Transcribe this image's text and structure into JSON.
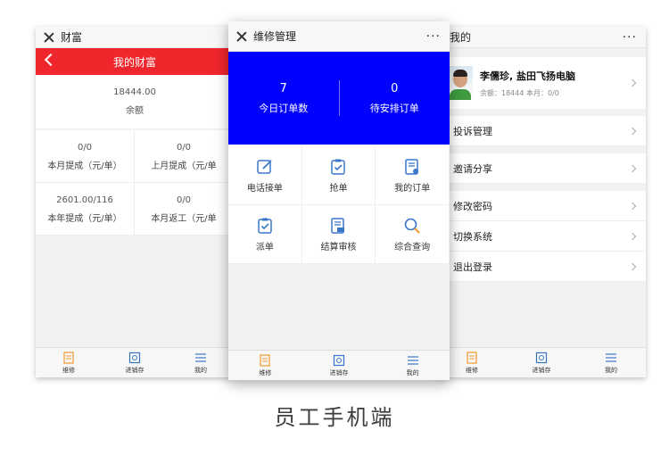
{
  "left_phone": {
    "window_title": "财富",
    "header_title": "我的财富",
    "balance": {
      "amount": "18444.00",
      "label": "余额"
    },
    "stats": [
      {
        "value": "0/0",
        "label": "本月提成（元/单）"
      },
      {
        "value": "0/0",
        "label": "上月提成（元/单"
      },
      {
        "value": "2601.00/116",
        "label": "本年提成（元/单）"
      },
      {
        "value": "0/0",
        "label": "本月返工（元/单"
      }
    ],
    "tabs": [
      {
        "label": "维修",
        "icon": "document-icon"
      },
      {
        "label": "进销存",
        "icon": "box-icon"
      },
      {
        "label": "我的",
        "icon": "menu-icon"
      }
    ]
  },
  "mid_phone": {
    "window_title": "维修管理",
    "more": "···",
    "stats": [
      {
        "value": "7",
        "label": "今日订单数"
      },
      {
        "value": "0",
        "label": "待安排订单"
      }
    ],
    "menu": [
      {
        "label": "电话接单",
        "icon": "edit-icon"
      },
      {
        "label": "抢单",
        "icon": "clipboard-check-icon"
      },
      {
        "label": "我的订单",
        "icon": "order-icon"
      },
      {
        "label": "派单",
        "icon": "clipboard-check-icon"
      },
      {
        "label": "结算审核",
        "icon": "audit-icon"
      },
      {
        "label": "综合查询",
        "icon": "search-icon"
      }
    ],
    "tabs": [
      {
        "label": "维修",
        "icon": "document-icon"
      },
      {
        "label": "进销存",
        "icon": "box-icon"
      },
      {
        "label": "我的",
        "icon": "menu-icon"
      }
    ]
  },
  "right_phone": {
    "window_title": "我的",
    "more": "···",
    "profile": {
      "name": "李儒珍, 盐田飞扬电脑",
      "sub": "余额：18444 本月：0/0"
    },
    "rows": [
      "投诉管理",
      "邀请分享",
      "修改密码",
      "切换系统",
      "退出登录"
    ],
    "tabs": [
      {
        "label": "维修",
        "icon": "document-icon"
      },
      {
        "label": "进销存",
        "icon": "box-icon"
      },
      {
        "label": "我的",
        "icon": "menu-icon"
      }
    ]
  },
  "caption": "员工手机端",
  "colors": {
    "red": "#f0262d",
    "blue": "#0000ff",
    "icon_blue": "#3a76c8",
    "icon_orange": "#f29a2e"
  }
}
